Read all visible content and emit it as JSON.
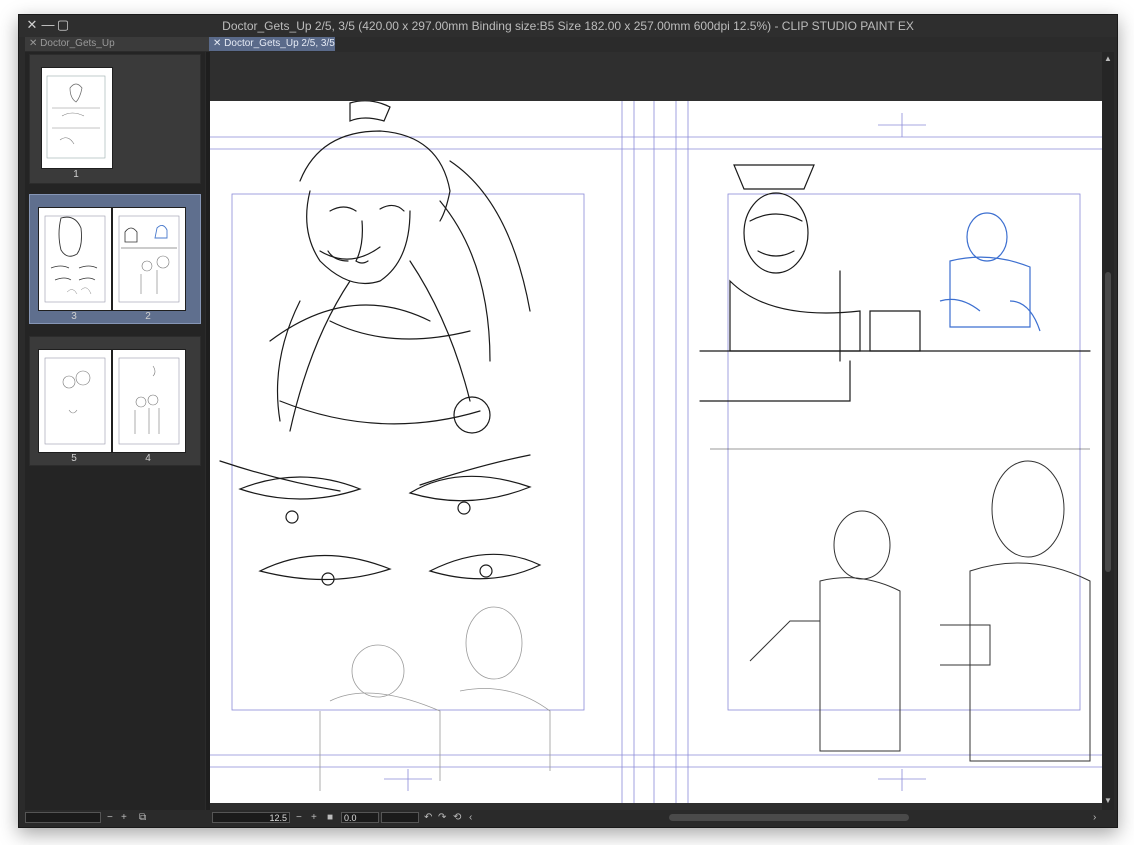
{
  "window": {
    "title": "Doctor_Gets_Up 2/5, 3/5 (420.00 x 297.00mm Binding size:B5 Size 182.00 x 257.00mm 600dpi 12.5%)  - CLIP STUDIO PAINT EX"
  },
  "tabs": {
    "left": "Doctor_Gets_Up",
    "main": "Doctor_Gets_Up 2/5, 3/5"
  },
  "navigator": {
    "cards": [
      {
        "pages": [
          "1"
        ],
        "selected": false
      },
      {
        "pages": [
          "3",
          "2"
        ],
        "selected": true
      },
      {
        "pages": [
          "5",
          "4"
        ],
        "selected": false
      }
    ]
  },
  "status": {
    "zoom": "12.5",
    "angle": "0.0"
  },
  "icons": {
    "close": "close-icon",
    "minimize": "minimize-icon",
    "maximize": "maximize-icon",
    "zoom_out": "zoom-out-icon",
    "zoom_in": "zoom-in-icon"
  }
}
